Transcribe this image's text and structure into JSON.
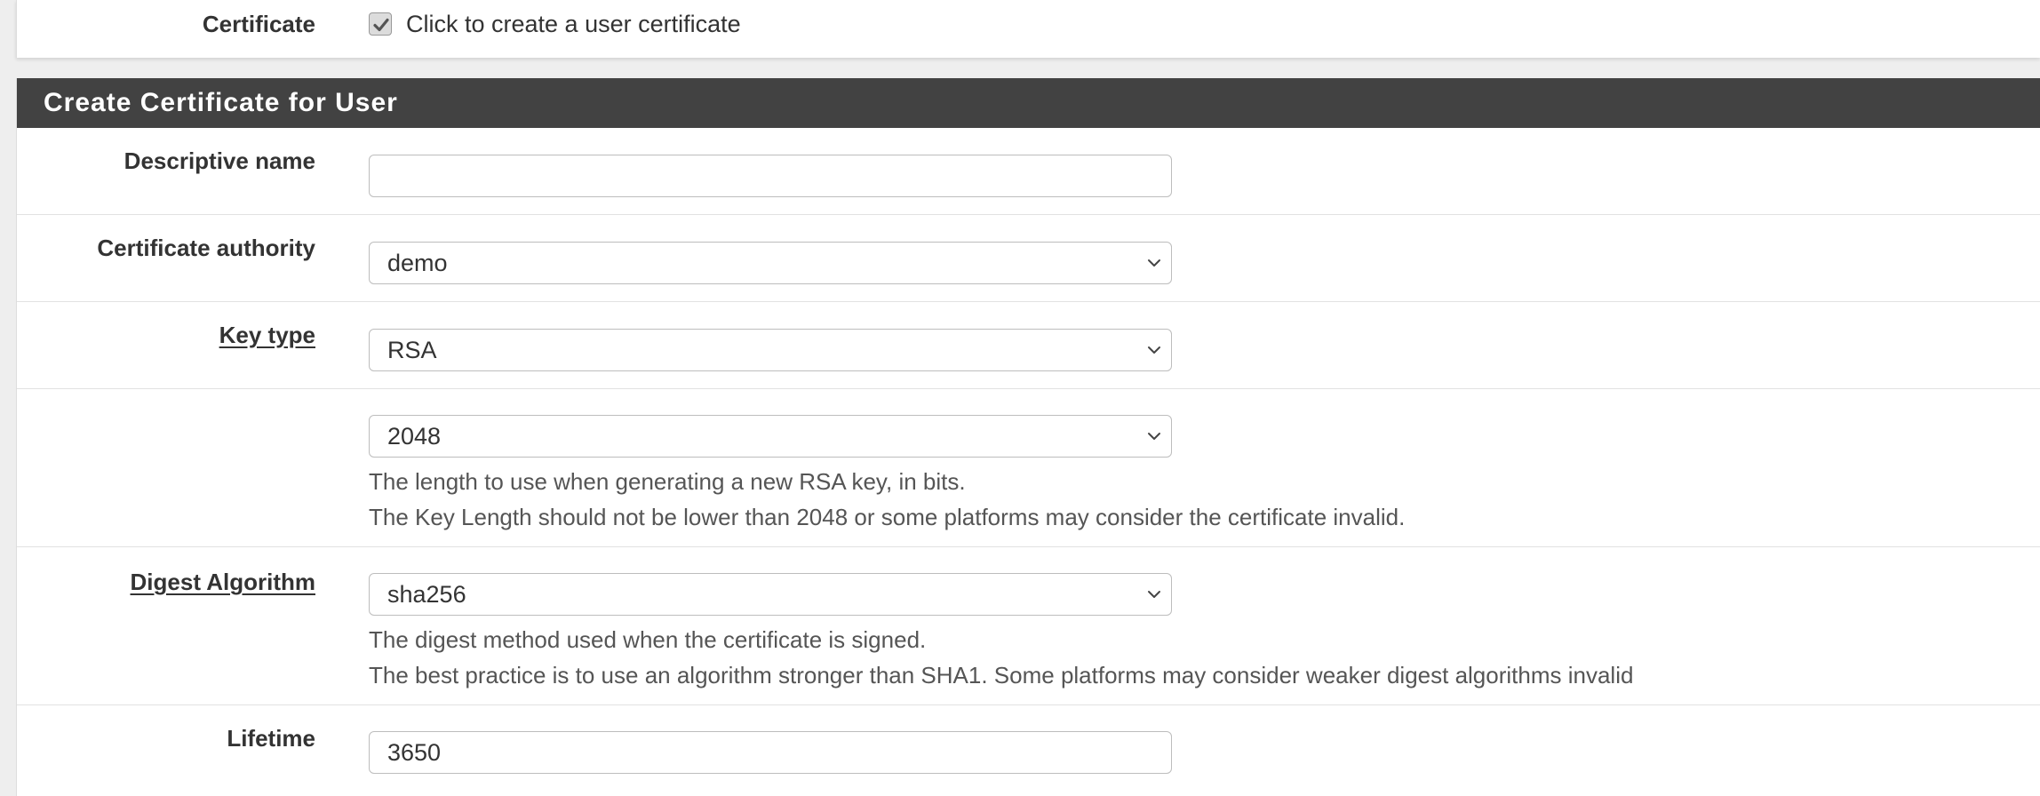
{
  "certificate_row": {
    "label": "Certificate",
    "checkbox_checked": true,
    "checkbox_text": "Click to create a user certificate"
  },
  "section": {
    "title": "Create Certificate for User"
  },
  "fields": {
    "descriptive_name": {
      "label": "Descriptive name",
      "value": ""
    },
    "certificate_authority": {
      "label": "Certificate authority",
      "selected": "demo"
    },
    "key_type": {
      "label": "Key type",
      "selected": "RSA"
    },
    "key_length": {
      "selected": "2048",
      "help_line1": "The length to use when generating a new RSA key, in bits.",
      "help_line2": "The Key Length should not be lower than 2048 or some platforms may consider the certificate invalid."
    },
    "digest_algorithm": {
      "label": "Digest Algorithm",
      "selected": "sha256",
      "help_line1": "The digest method used when the certificate is signed.",
      "help_line2": "The best practice is to use an algorithm stronger than SHA1. Some platforms may consider weaker digest algorithms invalid"
    },
    "lifetime": {
      "label": "Lifetime",
      "value": "3650"
    }
  },
  "icons": {
    "select_arrow": "chevron-down-icon",
    "checkbox_mark": "check-icon"
  },
  "colors": {
    "heading_bg": "#424242",
    "heading_text": "#ffffff",
    "panel_bg": "#ffffff",
    "page_bg": "#eeeeee"
  }
}
